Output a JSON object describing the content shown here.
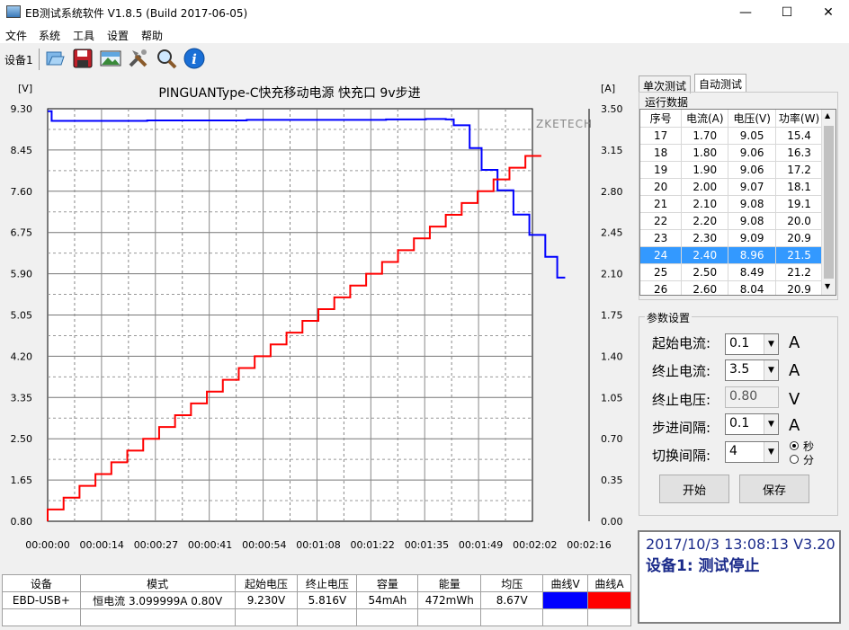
{
  "window": {
    "title": "EB测试系统软件 V1.8.5 (Build 2017-06-05)",
    "minimize": "—",
    "maximize": "☐",
    "close": "✕"
  },
  "menu": [
    "文件",
    "系统",
    "工具",
    "设置",
    "帮助"
  ],
  "toolbar": {
    "device_label": "设备1",
    "icons": [
      "folder-icon",
      "save-icon",
      "image-icon",
      "tools-icon",
      "search-icon",
      "info-icon"
    ]
  },
  "chart_data": {
    "type": "line",
    "title": "PINGUANType-C快充移动电源  快充口  9v步进",
    "watermark": "ZKETECH",
    "y_left_unit": "[V]",
    "y_right_unit": "[A]",
    "y_left_ticks": [
      "9.30",
      "8.45",
      "7.60",
      "6.75",
      "5.90",
      "5.05",
      "4.20",
      "3.35",
      "2.50",
      "1.65",
      "0.80"
    ],
    "y_right_ticks": [
      "3.50",
      "3.15",
      "2.80",
      "2.45",
      "2.10",
      "1.75",
      "1.40",
      "1.05",
      "0.70",
      "0.35",
      "0.00"
    ],
    "x_ticks": [
      "00:00:00",
      "00:00:14",
      "00:00:27",
      "00:00:41",
      "00:00:54",
      "00:01:08",
      "00:01:22",
      "00:01:35",
      "00:01:49",
      "00:02:02",
      "00:02:16"
    ],
    "ylim_left": [
      0.8,
      9.3
    ],
    "ylim_right": [
      0,
      3.5
    ],
    "xlim_seconds": [
      0,
      136
    ],
    "series": [
      {
        "color": "#0000ff",
        "axis": "left",
        "points": [
          [
            0,
            9.25
          ],
          [
            1,
            9.23
          ],
          [
            1,
            9.05
          ],
          [
            25,
            9.06
          ],
          [
            50,
            9.07
          ],
          [
            85,
            9.08
          ],
          [
            95,
            9.09
          ],
          [
            100,
            9.08
          ],
          [
            102,
            8.96
          ],
          [
            106,
            8.49
          ],
          [
            109,
            8.04
          ],
          [
            113,
            7.62
          ],
          [
            117,
            7.12
          ],
          [
            121,
            6.7
          ],
          [
            125,
            6.25
          ],
          [
            128,
            5.82
          ],
          [
            130,
            5.82
          ]
        ]
      },
      {
        "color": "#ff0000",
        "axis": "right",
        "start": 0.1,
        "end": 3.1,
        "step": 0.1,
        "step_seconds": 4
      }
    ]
  },
  "bottom_table": {
    "headers": [
      "设备",
      "模式",
      "起始电压",
      "终止电压",
      "容量",
      "能量",
      "均压",
      "曲线V",
      "曲线A"
    ],
    "row": [
      "EBD-USB+",
      "恒电流  3.099999A  0.80V",
      "9.230V",
      "5.816V",
      "54mAh",
      "472mWh",
      "8.67V",
      "",
      ""
    ],
    "curve_v_color": "#0000ff",
    "curve_a_color": "#ff0000"
  },
  "tabs": [
    "单次测试",
    "自动测试"
  ],
  "run_data": {
    "group_title": "运行数据",
    "headers": [
      "序号",
      "电流(A)",
      "电压(V)",
      "功率(W)"
    ],
    "rows": [
      [
        "17",
        "1.70",
        "9.05",
        "15.4"
      ],
      [
        "18",
        "1.80",
        "9.06",
        "16.3"
      ],
      [
        "19",
        "1.90",
        "9.06",
        "17.2"
      ],
      [
        "20",
        "2.00",
        "9.07",
        "18.1"
      ],
      [
        "21",
        "2.10",
        "9.08",
        "19.1"
      ],
      [
        "22",
        "2.20",
        "9.08",
        "20.0"
      ],
      [
        "23",
        "2.30",
        "9.09",
        "20.9"
      ],
      [
        "24",
        "2.40",
        "8.96",
        "21.5"
      ],
      [
        "25",
        "2.50",
        "8.49",
        "21.2"
      ],
      [
        "26",
        "2.60",
        "8.04",
        "20.9"
      ]
    ],
    "selected_index": 7
  },
  "params": {
    "group_title": "参数设置",
    "start_current_label": "起始电流:",
    "start_current_value": "0.1",
    "end_current_label": "终止电流:",
    "end_current_value": "3.5",
    "end_voltage_label": "终止电压:",
    "end_voltage_value": "0.80",
    "step_label": "步进间隔:",
    "step_value": "0.1",
    "switch_label": "切换间隔:",
    "switch_value": "4",
    "unit_a": "A",
    "unit_v": "V",
    "radio_sec": "秒",
    "radio_min": "分",
    "start_button": "开始",
    "save_button": "保存"
  },
  "status": {
    "line1": "2017/10/3  13:08:13  V3.20",
    "line2": "设备1: 测试停止"
  }
}
